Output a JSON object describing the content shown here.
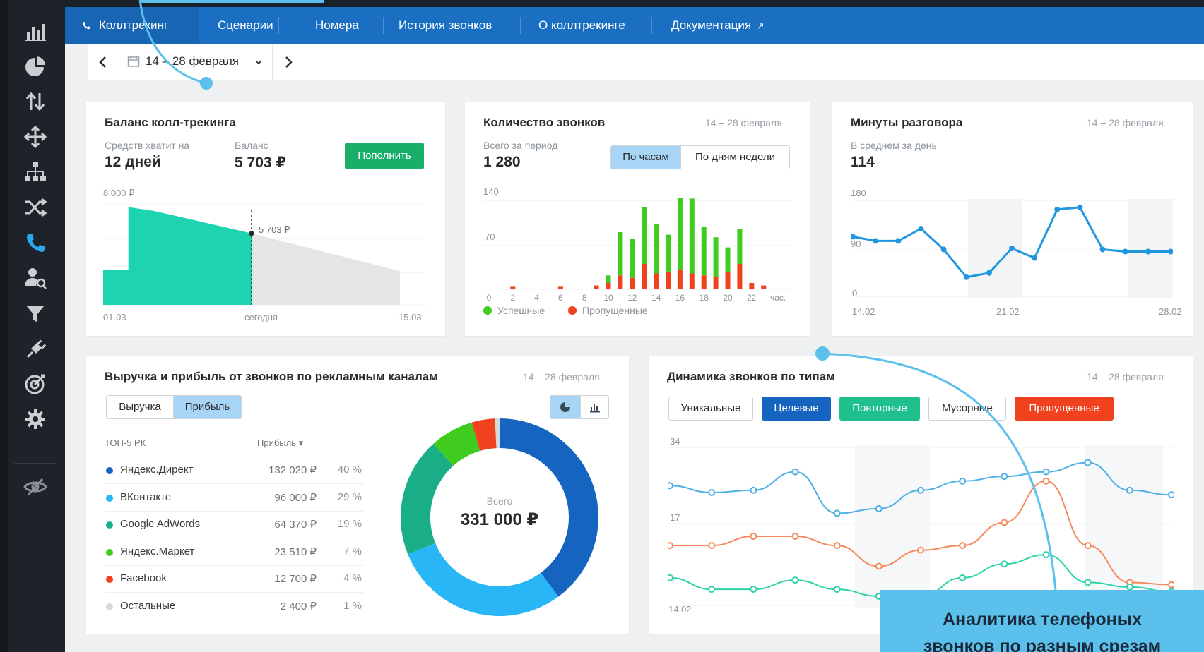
{
  "nav": {
    "items": [
      {
        "label": "Коллтрекинг",
        "active": true
      },
      {
        "label": "Сценарии"
      },
      {
        "label": "Номера"
      },
      {
        "label": "История звонков"
      },
      {
        "label": "О коллтрекинге"
      },
      {
        "label": "Документация"
      }
    ]
  },
  "datebar": {
    "range": "14 – 28 февраля"
  },
  "balance": {
    "title": "Баланс колл-трекинга",
    "enough_label": "Средств хватит на",
    "enough_value": "12 дней",
    "balance_label": "Баланс",
    "balance_value": "5 703 ₽",
    "topup_button": "Пополнить",
    "chart_max": "8 000 ₽",
    "marker_label": "5 703 ₽",
    "x_start": "01.03",
    "x_today": "сегодня",
    "x_end": "15.03"
  },
  "calls": {
    "title": "Количество звонков",
    "date": "14 – 28 февраля",
    "total_label": "Всего за период",
    "total_value": "1 280",
    "toggle_hours": "По часам",
    "toggle_weekdays": "По дням недели",
    "y_top": "140",
    "y_mid": "70",
    "x_ticks": [
      "0",
      "2",
      "4",
      "6",
      "8",
      "10",
      "12",
      "14",
      "16",
      "18",
      "20",
      "22"
    ],
    "x_unit": "час.",
    "legend_success": "Успешные",
    "legend_missed": "Пропущенные"
  },
  "minutes": {
    "title": "Минуты разговора",
    "date": "14 – 28 февраля",
    "avg_label": "В среднем за день",
    "avg_value": "114",
    "y_top": "180",
    "y_mid": "90",
    "y_zero": "0",
    "x_start": "14.02",
    "x_mid": "21.02",
    "x_end": "28.02"
  },
  "revenue": {
    "title": "Выручка и прибыль от звонков по рекламным каналам",
    "date": "14 – 28 февраля",
    "tab_revenue": "Выручка",
    "tab_profit": "Прибыль",
    "col_top": "ТОП-5 РК",
    "col_sort": "Прибыль ▾",
    "rows": [
      {
        "name": "Яндекс.Директ",
        "value": "132 020 ₽",
        "pct": "40 %",
        "color": "#1565c0"
      },
      {
        "name": "ВКонтакте",
        "value": "96 000 ₽",
        "pct": "29 %",
        "color": "#29b6f6"
      },
      {
        "name": "Google AdWords",
        "value": "64 370 ₽",
        "pct": "19 %",
        "color": "#1aae86"
      },
      {
        "name": "Яндекс.Маркет",
        "value": "23 510 ₽",
        "pct": "7 %",
        "color": "#3fcc1f"
      },
      {
        "name": "Facebook",
        "value": "12 700 ₽",
        "pct": "4 %",
        "color": "#f0421e"
      },
      {
        "name": "Остальные",
        "value": "2 400 ₽",
        "pct": "1 %",
        "color": "#d7dadd"
      }
    ],
    "donut_label": "Всего",
    "donut_value": "331 000 ₽"
  },
  "dynamics": {
    "title": "Динамика звонков по типам",
    "date": "14 – 28 февраля",
    "filters": [
      {
        "label": "Уникальные",
        "style": "outline"
      },
      {
        "label": "Целевые",
        "style": "filled",
        "color": "#1565c0"
      },
      {
        "label": "Повторные",
        "style": "filled",
        "color": "#1fc08e"
      },
      {
        "label": "Мусорные",
        "style": "outline"
      },
      {
        "label": "Пропущенные",
        "style": "filled",
        "color": "#f0421e"
      }
    ],
    "y_top": "34",
    "y_mid": "17",
    "x_start": "14.02"
  },
  "callout": {
    "line1": "Аналитика телефоных",
    "line2": "звонков по разным срезам"
  },
  "chart_data": [
    {
      "type": "area",
      "title": "Баланс колл-трекинга",
      "ylim": [
        0,
        8000
      ],
      "x_labels": [
        "01.03",
        "сегодня",
        "15.03"
      ],
      "note": "balance history then forecast",
      "points": [
        {
          "x": 0.0,
          "y": 2800,
          "kind": "history"
        },
        {
          "x": 0.085,
          "y": 2800,
          "kind": "history"
        },
        {
          "x": 0.085,
          "y": 7800,
          "kind": "history"
        },
        {
          "x": 0.17,
          "y": 7500,
          "kind": "history"
        },
        {
          "x": 0.3,
          "y": 6800,
          "kind": "history"
        },
        {
          "x": 0.5,
          "y": 5703,
          "kind": "history"
        },
        {
          "x": 1.0,
          "y": 2700,
          "kind": "forecast"
        }
      ]
    },
    {
      "type": "bar",
      "title": "Количество звонков",
      "ylim": [
        0,
        140
      ],
      "categories": [
        "0",
        "1",
        "2",
        "3",
        "4",
        "5",
        "6",
        "7",
        "8",
        "9",
        "10",
        "11",
        "12",
        "13",
        "14",
        "15",
        "16",
        "17",
        "18",
        "19",
        "20",
        "21",
        "22",
        "23"
      ],
      "series": [
        {
          "name": "Успешные",
          "values": [
            0,
            0,
            0,
            0,
            0,
            0,
            0,
            0,
            0,
            0,
            12,
            68,
            62,
            90,
            78,
            58,
            120,
            118,
            77,
            62,
            38,
            55,
            0,
            0
          ]
        },
        {
          "name": "Пропущенные",
          "values": [
            0,
            0,
            4,
            0,
            0,
            0,
            4,
            0,
            0,
            6,
            10,
            22,
            18,
            40,
            25,
            28,
            30,
            25,
            22,
            20,
            28,
            40,
            10,
            6
          ]
        }
      ]
    },
    {
      "type": "line",
      "title": "Минуты разговора",
      "ylim": [
        0,
        180
      ],
      "x": [
        "14.02",
        "15.02",
        "16.02",
        "17.02",
        "18.02",
        "19.02",
        "20.02",
        "21.02",
        "22.02",
        "23.02",
        "24.02",
        "25.02",
        "26.02",
        "27.02",
        "28.02"
      ],
      "series": [
        {
          "name": "Минуты",
          "values": [
            112,
            104,
            104,
            127,
            88,
            36,
            44,
            90,
            72,
            163,
            167,
            88,
            84,
            84,
            84
          ]
        }
      ]
    },
    {
      "type": "pie",
      "title": "Выручка и прибыль от звонков по рекламным каналам",
      "categories": [
        "Яндекс.Директ",
        "ВКонтакте",
        "Google AdWords",
        "Яндекс.Маркет",
        "Facebook",
        "Остальные"
      ],
      "values": [
        132020,
        96000,
        64370,
        23510,
        12700,
        2400
      ]
    },
    {
      "type": "line",
      "title": "Динамика звонков по типам",
      "ylim": [
        0,
        34
      ],
      "series": [
        {
          "name": "Уникальные",
          "values": [
            26,
            24.5,
            25,
            29,
            20,
            21,
            25,
            27,
            28,
            29,
            31,
            25,
            24
          ]
        },
        {
          "name": "Пропущенные",
          "values": [
            13,
            13,
            15,
            15,
            13,
            8.5,
            12,
            13,
            18,
            27,
            13,
            5,
            4.5
          ]
        },
        {
          "name": "Повторные",
          "values": [
            6,
            3.5,
            3.5,
            5.5,
            3.5,
            2,
            2,
            6,
            9,
            11,
            5,
            4,
            3
          ]
        }
      ]
    }
  ]
}
